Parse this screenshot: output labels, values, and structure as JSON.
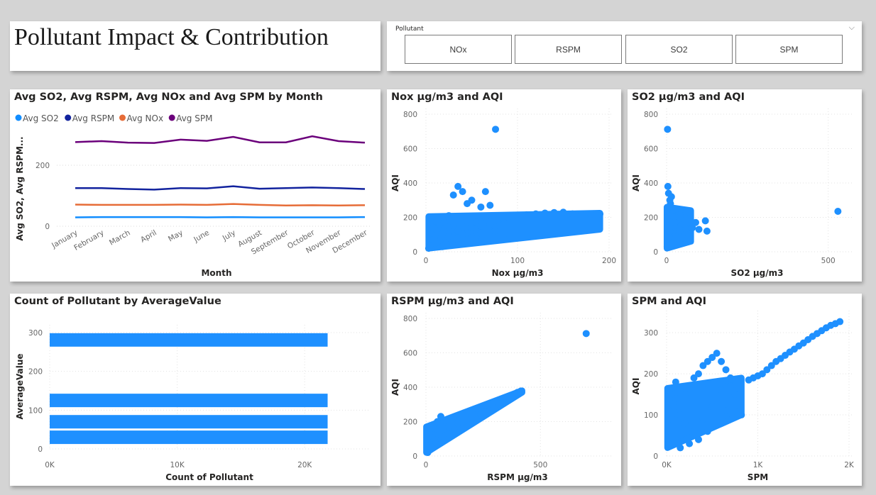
{
  "dashboard": {
    "title": "Pollutant Impact & Contribution"
  },
  "slicer": {
    "label": "Pollutant",
    "chevron_icon": "chevron-down-icon",
    "options": [
      "NOx",
      "RSPM",
      "SO2",
      "SPM"
    ]
  },
  "colors": {
    "so2": "#118dff",
    "rspm": "#12239e",
    "nox": "#e66c37",
    "spm": "#6b007b",
    "scatter": "#1e90ff",
    "bar": "#1e90ff"
  },
  "chart_data": [
    {
      "type": "line",
      "title": "Avg SO2, Avg RSPM, Avg NOx and Avg SPM by Month",
      "xlabel": "Month",
      "ylabel": "Avg SO2, Avg RSPM...",
      "categories": [
        "January",
        "February",
        "March",
        "April",
        "May",
        "June",
        "July",
        "August",
        "September",
        "October",
        "November",
        "December"
      ],
      "ylim": [
        0,
        320
      ],
      "yticks": [
        0,
        200
      ],
      "legend_position": "top-left",
      "grid": true,
      "series": [
        {
          "name": "Avg SO2",
          "color": "#118dff",
          "values": [
            29,
            30,
            30,
            30,
            30,
            29,
            30,
            29,
            29,
            29,
            29,
            30
          ]
        },
        {
          "name": "Avg RSPM",
          "color": "#12239e",
          "values": [
            125,
            125,
            122,
            120,
            125,
            124,
            131,
            123,
            125,
            127,
            125,
            122
          ]
        },
        {
          "name": "Avg NOx",
          "color": "#e66c37",
          "values": [
            71,
            70,
            70,
            70,
            71,
            70,
            73,
            70,
            68,
            69,
            68,
            69
          ]
        },
        {
          "name": "Avg SPM",
          "color": "#6b007b",
          "values": [
            276,
            279,
            274,
            273,
            284,
            280,
            293,
            275,
            275,
            295,
            279,
            274
          ]
        }
      ]
    },
    {
      "type": "scatter",
      "title": "Nox µg/m3 and AQI",
      "xlabel": "Nox µg/m3",
      "ylabel": "AQI",
      "xlim": [
        0,
        200
      ],
      "ylim": [
        0,
        800
      ],
      "xticks": [
        {
          "v": 0,
          "t": "0"
        },
        {
          "v": 100,
          "t": "100"
        },
        {
          "v": 200,
          "t": "200"
        }
      ],
      "yticks": [
        {
          "v": 0,
          "t": "0"
        },
        {
          "v": 200,
          "t": "200"
        },
        {
          "v": 400,
          "t": "400"
        },
        {
          "v": 600,
          "t": "600"
        },
        {
          "v": 800,
          "t": "800"
        }
      ],
      "points": [
        [
          3,
          20
        ],
        [
          5,
          40
        ],
        [
          8,
          70
        ],
        [
          10,
          100
        ],
        [
          12,
          130
        ],
        [
          15,
          160
        ],
        [
          18,
          190
        ],
        [
          8,
          140
        ],
        [
          14,
          200
        ],
        [
          20,
          170
        ],
        [
          25,
          60
        ],
        [
          30,
          150
        ],
        [
          35,
          120
        ],
        [
          40,
          180
        ],
        [
          45,
          110
        ],
        [
          50,
          140
        ],
        [
          55,
          170
        ],
        [
          60,
          150
        ],
        [
          65,
          200
        ],
        [
          70,
          160
        ],
        [
          75,
          180
        ],
        [
          80,
          190
        ],
        [
          85,
          195
        ],
        [
          90,
          200
        ],
        [
          95,
          205
        ],
        [
          100,
          210
        ],
        [
          110,
          215
        ],
        [
          120,
          220
        ],
        [
          130,
          225
        ],
        [
          140,
          228
        ],
        [
          150,
          230
        ],
        [
          160,
          220
        ],
        [
          170,
          215
        ],
        [
          180,
          218
        ],
        [
          190,
          220
        ],
        [
          5,
          200
        ],
        [
          10,
          180
        ],
        [
          20,
          120
        ],
        [
          25,
          90
        ],
        [
          35,
          80
        ],
        [
          40,
          100
        ],
        [
          30,
          330
        ],
        [
          35,
          380
        ],
        [
          40,
          350
        ],
        [
          45,
          280
        ],
        [
          50,
          300
        ],
        [
          60,
          260
        ],
        [
          65,
          350
        ],
        [
          70,
          270
        ],
        [
          25,
          210
        ],
        [
          15,
          60
        ],
        [
          10,
          50
        ],
        [
          22,
          45
        ],
        [
          45,
          60
        ],
        [
          55,
          90
        ],
        [
          75,
          120
        ],
        [
          60,
          110
        ],
        [
          50,
          80
        ],
        [
          30,
          40
        ],
        [
          18,
          30
        ],
        [
          76,
          712
        ]
      ],
      "bands": [
        {
          "x0": 3,
          "x1": 190,
          "lo0": 20,
          "lo1": 130,
          "hi0": 205,
          "hi1": 225
        }
      ]
    },
    {
      "type": "scatter",
      "title": "SO2 µg/m3 and AQI",
      "xlabel": "SO2 µg/m3",
      "ylabel": "AQI",
      "xlim": [
        0,
        560
      ],
      "ylim": [
        0,
        800
      ],
      "xticks": [
        {
          "v": 0,
          "t": "0"
        },
        {
          "v": 500,
          "t": "500"
        }
      ],
      "yticks": [
        {
          "v": 0,
          "t": "0"
        },
        {
          "v": 200,
          "t": "200"
        },
        {
          "v": 400,
          "t": "400"
        },
        {
          "v": 600,
          "t": "600"
        },
        {
          "v": 800,
          "t": "800"
        }
      ],
      "points": [
        [
          2,
          30
        ],
        [
          5,
          60
        ],
        [
          8,
          90
        ],
        [
          10,
          120
        ],
        [
          12,
          150
        ],
        [
          15,
          180
        ],
        [
          18,
          210
        ],
        [
          20,
          240
        ],
        [
          22,
          200
        ],
        [
          25,
          170
        ],
        [
          28,
          140
        ],
        [
          30,
          110
        ],
        [
          35,
          90
        ],
        [
          40,
          120
        ],
        [
          45,
          150
        ],
        [
          50,
          180
        ],
        [
          55,
          160
        ],
        [
          60,
          130
        ],
        [
          65,
          110
        ],
        [
          70,
          100
        ],
        [
          8,
          260
        ],
        [
          10,
          300
        ],
        [
          6,
          340
        ],
        [
          4,
          380
        ],
        [
          12,
          280
        ],
        [
          15,
          320
        ],
        [
          3,
          712
        ],
        [
          120,
          180
        ],
        [
          125,
          120
        ],
        [
          80,
          140
        ],
        [
          90,
          170
        ],
        [
          100,
          130
        ],
        [
          530,
          235
        ],
        [
          35,
          60
        ],
        [
          20,
          50
        ],
        [
          50,
          80
        ],
        [
          15,
          40
        ],
        [
          40,
          200
        ],
        [
          60,
          230
        ],
        [
          30,
          250
        ]
      ],
      "bands": [
        {
          "x0": 1,
          "x1": 75,
          "lo0": 20,
          "lo1": 60,
          "hi0": 260,
          "hi1": 240
        }
      ]
    },
    {
      "type": "bar",
      "orientation": "horizontal",
      "title": "Count of Pollutant by AverageValue",
      "xlabel": "Count of Pollutant",
      "ylabel": "AverageValue",
      "xlim": [
        0,
        25000
      ],
      "ylim": [
        0,
        320
      ],
      "xticks": [
        {
          "v": 0,
          "t": "0K"
        },
        {
          "v": 10000,
          "t": "10K"
        },
        {
          "v": 20000,
          "t": "20K"
        }
      ],
      "yticks": [
        {
          "v": 0,
          "t": "0"
        },
        {
          "v": 100,
          "t": "100"
        },
        {
          "v": 200,
          "t": "200"
        },
        {
          "v": 300,
          "t": "300"
        }
      ],
      "bars": [
        {
          "category": 281,
          "value": 21800
        },
        {
          "category": 125,
          "value": 21800
        },
        {
          "category": 70,
          "value": 21800
        },
        {
          "category": 30,
          "value": 21800
        }
      ]
    },
    {
      "type": "scatter",
      "title": "RSPM µg/m3 and AQI",
      "xlabel": "RSPM µg/m3",
      "ylabel": "AQI",
      "xlim": [
        0,
        800
      ],
      "ylim": [
        0,
        800
      ],
      "xticks": [
        {
          "v": 0,
          "t": "0"
        },
        {
          "v": 500,
          "t": "500"
        }
      ],
      "yticks": [
        {
          "v": 0,
          "t": "0"
        },
        {
          "v": 200,
          "t": "200"
        },
        {
          "v": 400,
          "t": "400"
        },
        {
          "v": 600,
          "t": "600"
        },
        {
          "v": 800,
          "t": "800"
        }
      ],
      "points": [
        [
          5,
          40
        ],
        [
          10,
          60
        ],
        [
          15,
          80
        ],
        [
          20,
          100
        ],
        [
          30,
          120
        ],
        [
          40,
          110
        ],
        [
          50,
          130
        ],
        [
          60,
          140
        ],
        [
          70,
          150
        ],
        [
          80,
          160
        ],
        [
          100,
          170
        ],
        [
          120,
          180
        ],
        [
          140,
          190
        ],
        [
          160,
          200
        ],
        [
          180,
          210
        ],
        [
          200,
          215
        ],
        [
          220,
          225
        ],
        [
          240,
          240
        ],
        [
          260,
          255
        ],
        [
          280,
          265
        ],
        [
          300,
          280
        ],
        [
          320,
          300
        ],
        [
          340,
          310
        ],
        [
          360,
          330
        ],
        [
          380,
          350
        ],
        [
          400,
          370
        ],
        [
          415,
          378
        ],
        [
          10,
          140
        ],
        [
          20,
          160
        ],
        [
          30,
          180
        ],
        [
          50,
          200
        ],
        [
          65,
          230
        ],
        [
          5,
          100
        ],
        [
          8,
          20
        ],
        [
          25,
          50
        ],
        [
          700,
          712
        ]
      ],
      "bands": [
        {
          "x0": 2,
          "x1": 420,
          "lo0": 20,
          "lo1": 370,
          "hi0": 170,
          "hi1": 380
        }
      ]
    },
    {
      "type": "scatter",
      "title": "SPM and AQI",
      "xlabel": "SPM",
      "ylabel": "AQI",
      "xlim": [
        0,
        2000
      ],
      "ylim": [
        0,
        340
      ],
      "xticks": [
        {
          "v": 0,
          "t": "0K"
        },
        {
          "v": 1000,
          "t": "1K"
        },
        {
          "v": 2000,
          "t": "2K"
        }
      ],
      "yticks": [
        {
          "v": 0,
          "t": "0"
        },
        {
          "v": 100,
          "t": "100"
        },
        {
          "v": 200,
          "t": "200"
        },
        {
          "v": 300,
          "t": "300"
        }
      ],
      "points": [
        [
          20,
          30
        ],
        [
          40,
          60
        ],
        [
          60,
          90
        ],
        [
          80,
          120
        ],
        [
          100,
          140
        ],
        [
          150,
          100
        ],
        [
          200,
          150
        ],
        [
          250,
          170
        ],
        [
          300,
          190
        ],
        [
          350,
          200
        ],
        [
          400,
          220
        ],
        [
          450,
          230
        ],
        [
          500,
          240
        ],
        [
          550,
          250
        ],
        [
          600,
          230
        ],
        [
          650,
          210
        ],
        [
          700,
          190
        ],
        [
          750,
          150
        ],
        [
          800,
          110
        ],
        [
          820,
          100
        ],
        [
          900,
          185
        ],
        [
          950,
          190
        ],
        [
          1000,
          195
        ],
        [
          1050,
          200
        ],
        [
          1100,
          210
        ],
        [
          1150,
          220
        ],
        [
          1200,
          230
        ],
        [
          1250,
          237
        ],
        [
          1300,
          245
        ],
        [
          1350,
          253
        ],
        [
          1400,
          260
        ],
        [
          1450,
          268
        ],
        [
          1500,
          275
        ],
        [
          1550,
          283
        ],
        [
          1600,
          291
        ],
        [
          1650,
          298
        ],
        [
          1700,
          305
        ],
        [
          1750,
          312
        ],
        [
          1800,
          318
        ],
        [
          1850,
          322
        ],
        [
          1900,
          327
        ],
        [
          30,
          160
        ],
        [
          50,
          150
        ],
        [
          100,
          180
        ],
        [
          200,
          80
        ],
        [
          300,
          60
        ],
        [
          400,
          90
        ],
        [
          500,
          120
        ],
        [
          600,
          160
        ],
        [
          700,
          170
        ],
        [
          650,
          110
        ],
        [
          550,
          75
        ],
        [
          450,
          60
        ],
        [
          350,
          40
        ],
        [
          250,
          30
        ],
        [
          150,
          20
        ]
      ],
      "bands": [
        {
          "x0": 10,
          "x1": 820,
          "lo0": 20,
          "lo1": 100,
          "hi0": 165,
          "hi1": 190
        }
      ]
    }
  ]
}
